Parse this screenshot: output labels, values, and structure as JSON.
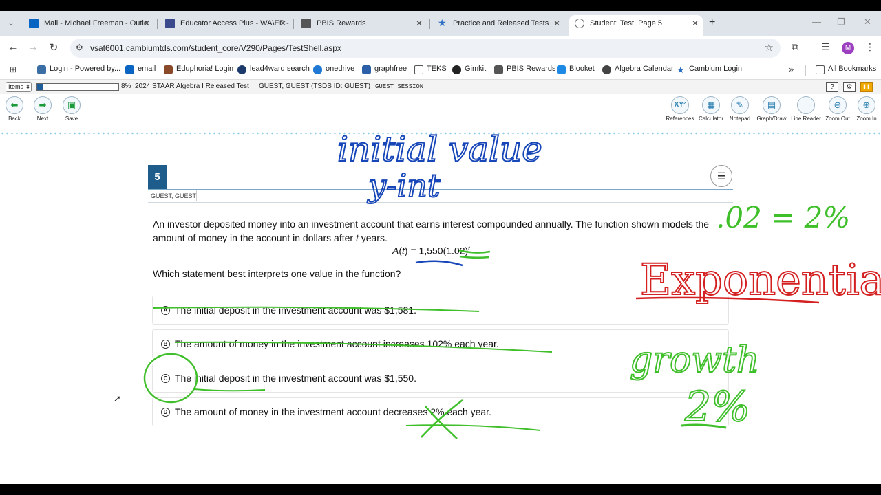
{
  "browser": {
    "tabs": [
      {
        "label": "Mail - Michael Freeman - Outlo",
        "close": "✕",
        "color": "#0a64c2"
      },
      {
        "label": "Educator Access Plus - WA\\EP -",
        "close": "✕",
        "color": "#3b4a8c"
      },
      {
        "label": "PBIS Rewards",
        "close": "✕",
        "color": "#555555"
      },
      {
        "label": "Practice and Released Tests",
        "close": "✕",
        "color": "#2d6fc2"
      },
      {
        "label": "Student: Test, Page 5",
        "close": "✕",
        "color": "#666666"
      }
    ],
    "new_tab": "+",
    "url": "vsat6001.cambiumtds.com/student_core/V290/Pages/TestShell.aspx",
    "avatar_letter": "M"
  },
  "bookmarks": {
    "items": [
      {
        "label": "Login - Powered by...",
        "color": "#3a6ea5"
      },
      {
        "label": "email",
        "color": "#0a64c2"
      },
      {
        "label": "Eduphoria! Login",
        "color": "#8a4a2a"
      },
      {
        "label": "lead4ward search",
        "color": "#1b3a6b"
      },
      {
        "label": "onedrive",
        "color": "#1e78d4"
      },
      {
        "label": "graphfree",
        "color": "#2b5fa8"
      },
      {
        "label": "TEKS",
        "color": "#ffffff"
      },
      {
        "label": "Gimkit",
        "color": "#222222"
      },
      {
        "label": "PBIS Rewards",
        "color": "#555555"
      },
      {
        "label": "Blooket",
        "color": "#1e88e5"
      },
      {
        "label": "Algebra Calendar",
        "color": "#444444"
      },
      {
        "label": "Cambium Login",
        "color": "#2d6fc2"
      }
    ],
    "more": "»",
    "all_bookmarks": "All Bookmarks"
  },
  "test_header": {
    "items_label": "Items",
    "progress_percent": 8,
    "progress_text": "8%",
    "test_name": "2024 STAAR Algebra I Released Test",
    "student": "GUEST, GUEST (TSDS ID: GUEST)",
    "session": "GUEST SESSION",
    "help": "?",
    "settings": "⚙",
    "pause": "❚❚"
  },
  "toolbar": {
    "back": "Back",
    "next": "Next",
    "save": "Save",
    "tools": [
      "References",
      "Calculator",
      "Notepad",
      "Graph/Draw",
      "Line Reader",
      "Zoom Out",
      "Zoom In"
    ],
    "references_glyph": "XY²"
  },
  "question": {
    "number": "5",
    "student_label": "GUEST, GUEST",
    "stem_part1": "An investor deposited money into an investment account that earns interest compounded annually. The function shown models the amount of money in the account in dollars after",
    "stem_var": "t",
    "stem_part2": "years.",
    "formula_lhs": "A",
    "formula_var": "t",
    "formula_rhs": "= 1,550(1.02)",
    "formula_exp": "t",
    "prompt": "Which statement best interprets one value in the function?",
    "options": [
      {
        "letter": "A",
        "text": "The initial deposit in the investment account was $1,581."
      },
      {
        "letter": "B",
        "text": "The amount of money in the investment account increases 102% each year."
      },
      {
        "letter": "C",
        "text": "The initial deposit in the investment account was $1,550."
      },
      {
        "letter": "D",
        "text": "The amount of money in the investment account decreases 2% each year."
      }
    ]
  },
  "annotations": {
    "initial_value": "initial value",
    "y_int": "y-int",
    "rate": ".02 = 2%",
    "type": "Exponential",
    "growth": "growth",
    "pct": "2%",
    "blue_ink": "#1646b8",
    "green_ink": "#3fbf2a",
    "red_ink": "#d42020"
  }
}
